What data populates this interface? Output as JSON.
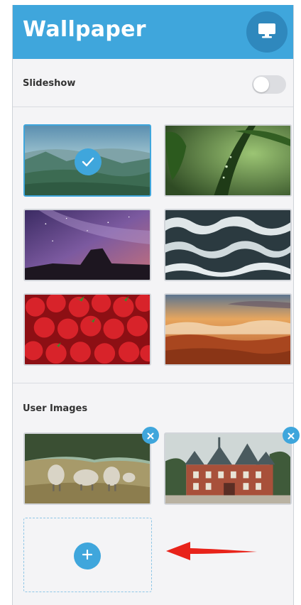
{
  "header": {
    "title": "Wallpaper",
    "display_icon": "monitor-icon"
  },
  "slideshow": {
    "label": "Slideshow",
    "enabled": false
  },
  "wallpapers": [
    {
      "name": "mountain-valley",
      "selected": true
    },
    {
      "name": "green-leaf",
      "selected": false
    },
    {
      "name": "milky-way",
      "selected": false
    },
    {
      "name": "ocean-waves",
      "selected": false
    },
    {
      "name": "strawberries",
      "selected": false
    },
    {
      "name": "sunset-clouds",
      "selected": false
    }
  ],
  "user_images": {
    "label": "User Images",
    "items": [
      {
        "name": "sheep-field"
      },
      {
        "name": "castle"
      }
    ]
  },
  "colors": {
    "accent": "#3fa6dc",
    "accent_dark": "#2f88bd",
    "annotation_arrow": "#e8231a"
  }
}
